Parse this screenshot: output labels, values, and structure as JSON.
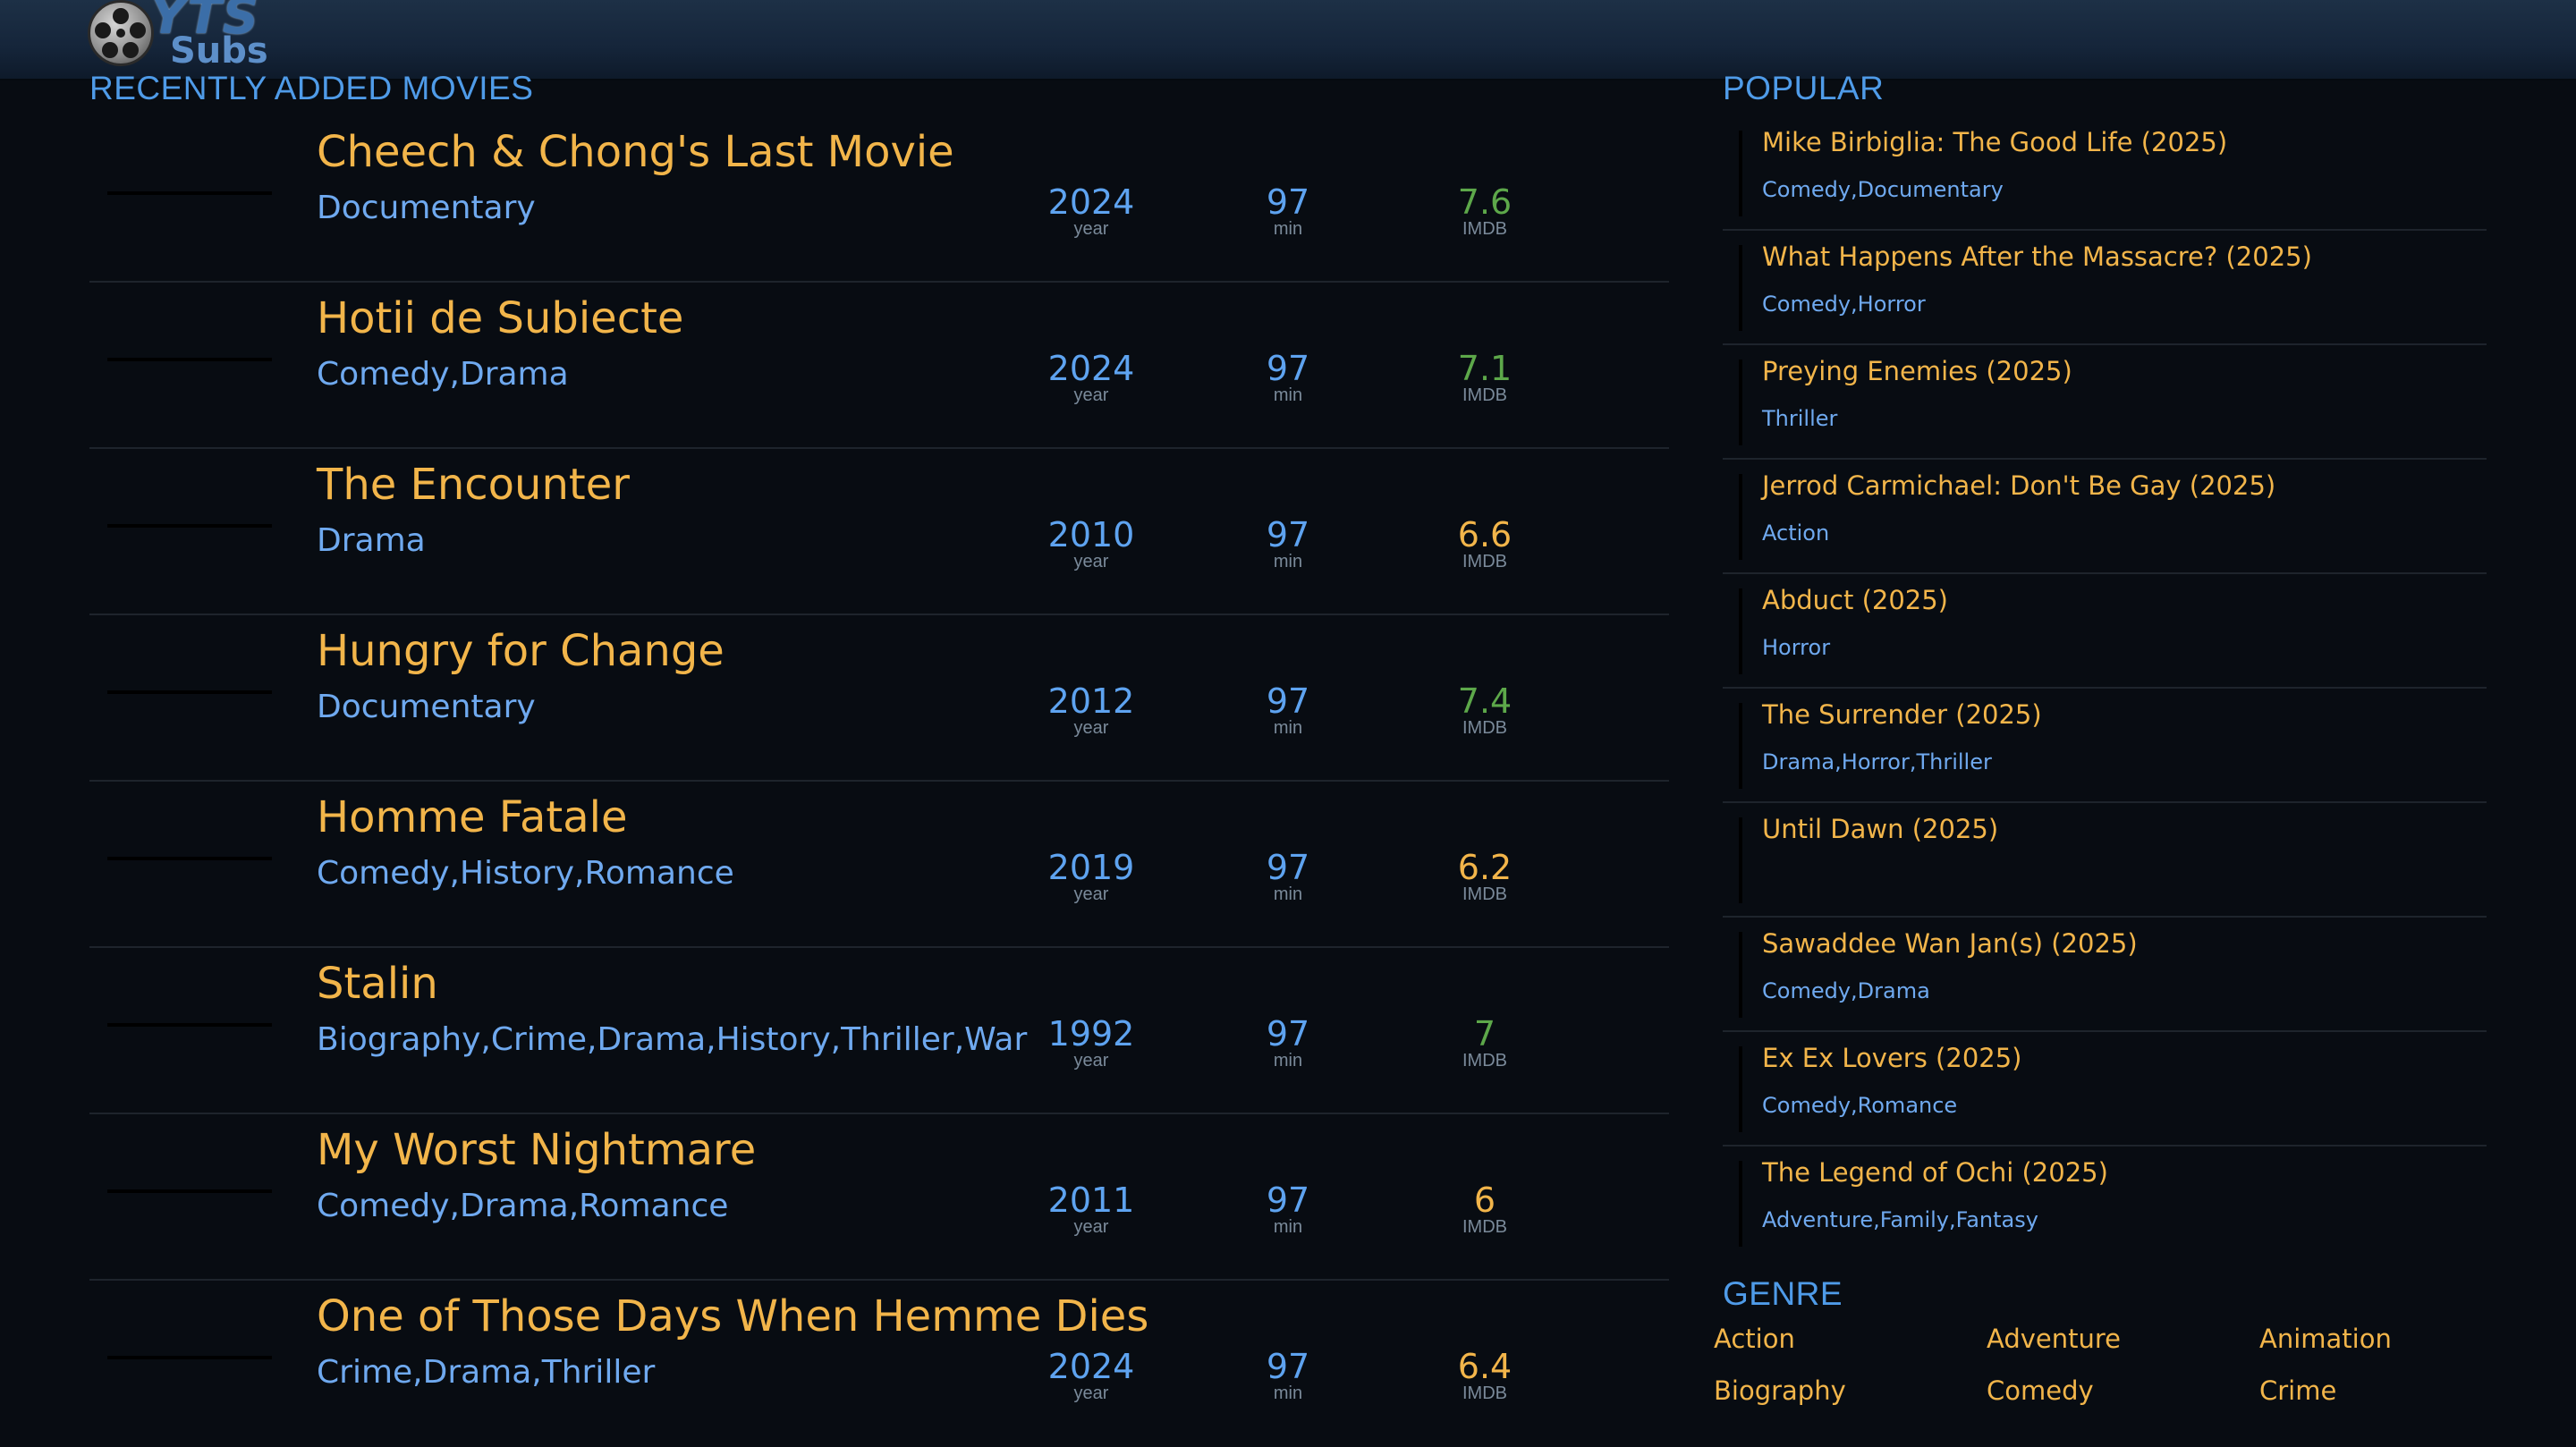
{
  "logo": {
    "text_main": "YTS",
    "text_sub": "Subs"
  },
  "recent": {
    "title": "RECENTLY ADDED MOVIES",
    "labels": {
      "year": "year",
      "min": "min",
      "imdb": "IMDB"
    },
    "movies": [
      {
        "title": "Cheech & Chong's Last Movie",
        "genres": "Documentary",
        "year": "2024",
        "minutes": "97",
        "rating": "7.6",
        "rating_color": "#5da84a"
      },
      {
        "title": "Hotii de Subiecte",
        "genres": "Comedy,Drama",
        "year": "2024",
        "minutes": "97",
        "rating": "7.1",
        "rating_color": "#5da84a"
      },
      {
        "title": "The Encounter",
        "genres": "Drama",
        "year": "2010",
        "minutes": "97",
        "rating": "6.6",
        "rating_color": "#f2b54a"
      },
      {
        "title": "Hungry for Change",
        "genres": "Documentary",
        "year": "2012",
        "minutes": "97",
        "rating": "7.4",
        "rating_color": "#5da84a"
      },
      {
        "title": "Homme Fatale",
        "genres": "Comedy,History,Romance",
        "year": "2019",
        "minutes": "97",
        "rating": "6.2",
        "rating_color": "#f2b54a"
      },
      {
        "title": "Stalin",
        "genres": "Biography,Crime,Drama,History,Thriller,War",
        "year": "1992",
        "minutes": "97",
        "rating": "7",
        "rating_color": "#5da84a"
      },
      {
        "title": "My Worst Nightmare",
        "genres": "Comedy,Drama,Romance",
        "year": "2011",
        "minutes": "97",
        "rating": "6",
        "rating_color": "#f2b54a"
      },
      {
        "title": "One of Those Days When Hemme Dies",
        "genres": "Crime,Drama,Thriller",
        "year": "2024",
        "minutes": "97",
        "rating": "6.4",
        "rating_color": "#f2b54a"
      }
    ]
  },
  "popular": {
    "title": "POPULAR",
    "items": [
      {
        "title": "Mike Birbiglia: The Good Life (2025)",
        "genres": "Comedy,Documentary"
      },
      {
        "title": "What Happens After the Massacre? (2025)",
        "genres": "Comedy,Horror"
      },
      {
        "title": "Preying Enemies (2025)",
        "genres": "Thriller"
      },
      {
        "title": "Jerrod Carmichael: Don't Be Gay (2025)",
        "genres": "Action"
      },
      {
        "title": "Abduct (2025)",
        "genres": "Horror"
      },
      {
        "title": "The Surrender (2025)",
        "genres": "Drama,Horror,Thriller"
      },
      {
        "title": "Until Dawn (2025)",
        "genres": ""
      },
      {
        "title": "Sawaddee Wan Jan(s) (2025)",
        "genres": "Comedy,Drama"
      },
      {
        "title": "Ex Ex Lovers (2025)",
        "genres": "Comedy,Romance"
      },
      {
        "title": "The Legend of Ochi (2025)",
        "genres": "Adventure,Family,Fantasy"
      }
    ]
  },
  "genre": {
    "title": "GENRE",
    "items": [
      "Action",
      "Adventure",
      "Animation",
      "Biography",
      "Comedy",
      "Crime"
    ]
  },
  "colors": {
    "accent_blue": "#4f9be8",
    "title_gold": "#f2b54a",
    "rating_green": "#5da84a",
    "background": "#080c12"
  }
}
